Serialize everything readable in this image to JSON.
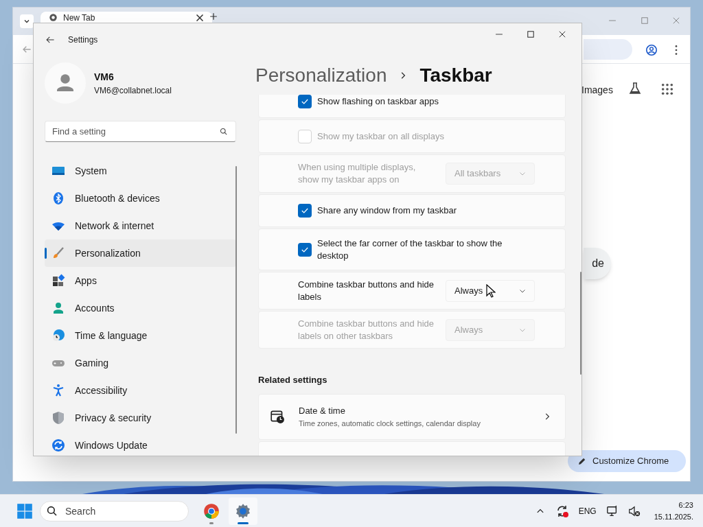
{
  "browser": {
    "tab_title": "New Tab",
    "search_links": [
      "Images"
    ],
    "partial_button": "de",
    "customize_button": "Customize Chrome"
  },
  "settings": {
    "title": "Settings",
    "user": {
      "name": "VM6",
      "email": "VM6@collabnet.local"
    },
    "search": {
      "placeholder": "Find a setting"
    },
    "nav": [
      {
        "label": "System",
        "selected": false
      },
      {
        "label": "Bluetooth & devices",
        "selected": false
      },
      {
        "label": "Network & internet",
        "selected": false
      },
      {
        "label": "Personalization",
        "selected": true
      },
      {
        "label": "Apps",
        "selected": false
      },
      {
        "label": "Accounts",
        "selected": false
      },
      {
        "label": "Time & language",
        "selected": false
      },
      {
        "label": "Gaming",
        "selected": false
      },
      {
        "label": "Accessibility",
        "selected": false
      },
      {
        "label": "Privacy & security",
        "selected": false
      },
      {
        "label": "Windows Update",
        "selected": false
      }
    ],
    "breadcrumb": [
      "Personalization",
      "Taskbar"
    ],
    "rows": [
      {
        "kind": "checkbox",
        "label": "Show flashing on taskbar apps",
        "checked": true,
        "disabled": false
      },
      {
        "kind": "checkbox",
        "label": "Show my taskbar on all displays",
        "checked": false,
        "disabled": true
      },
      {
        "kind": "dropdown",
        "label": "When using multiple displays, show my taskbar apps on",
        "value": "All taskbars",
        "disabled": true
      },
      {
        "kind": "checkbox",
        "label": "Share any window from my taskbar",
        "checked": true,
        "disabled": false
      },
      {
        "kind": "checkbox",
        "label": "Select the far corner of the taskbar to show the desktop",
        "checked": true,
        "disabled": false
      },
      {
        "kind": "dropdown",
        "label": "Combine taskbar buttons and hide labels",
        "value": "Always",
        "disabled": false
      },
      {
        "kind": "dropdown",
        "label": "Combine taskbar buttons and hide labels on other taskbars",
        "value": "Always",
        "disabled": true
      }
    ],
    "related_heading": "Related settings",
    "related": [
      {
        "title": "Date & time",
        "description": "Time zones, automatic clock settings, calendar display"
      }
    ]
  },
  "taskbar": {
    "search_placeholder": "Search",
    "apps": [
      {
        "kind": "chrome",
        "selected": false
      },
      {
        "kind": "settings",
        "selected": true
      }
    ],
    "language": "ENG",
    "time": "6:23",
    "date": "15.11.2025."
  }
}
